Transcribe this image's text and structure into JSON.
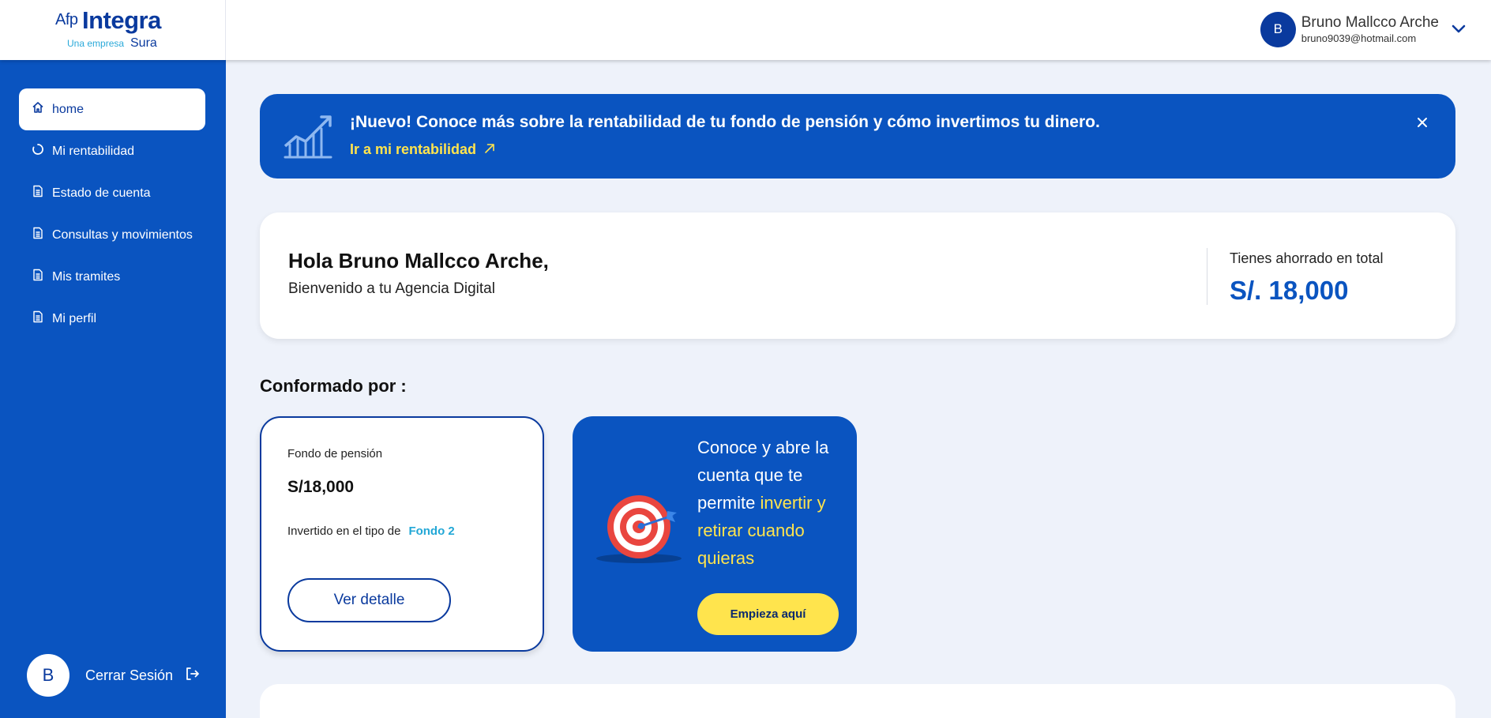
{
  "logo": {
    "afp": "Afp",
    "integra": "Integra",
    "tagline": "Una empresa",
    "parent": "Sura"
  },
  "header": {
    "avatar_initial": "B",
    "user_name": "Bruno Mallcco Arche",
    "user_email": "bruno9039@hotmail.com",
    "chevron_icon": "chevron-down-icon"
  },
  "sidebar": {
    "items": [
      {
        "label": "home",
        "icon": "home-icon",
        "active": true
      },
      {
        "label": "Mi rentabilidad",
        "icon": "loading-circle-icon",
        "active": false
      },
      {
        "label": "Estado de cuenta",
        "icon": "document-icon",
        "active": false
      },
      {
        "label": "Consultas y movimientos",
        "icon": "document-icon",
        "active": false
      },
      {
        "label": "Mis tramites",
        "icon": "document-icon",
        "active": false
      },
      {
        "label": "Mi perfil",
        "icon": "document-icon",
        "active": false
      }
    ],
    "logout": {
      "avatar_initial": "B",
      "label": "Cerrar Sesión",
      "icon": "logout-icon"
    }
  },
  "banner": {
    "icon": "growth-chart-icon",
    "title": "¡Nuevo! Conoce más sobre la rentabilidad de tu fondo de pensión y cómo invertimos tu dinero.",
    "link_label": "Ir a mi rentabilidad",
    "link_icon": "arrow-up-right-icon",
    "close_icon": "close-icon"
  },
  "greeting": {
    "title": "Hola Bruno Mallcco Arche,",
    "subtitle": "Bienvenido a tu Agencia Digital",
    "total_label": "Tienes ahorrado en total",
    "total_value": "S/. 18,000"
  },
  "section": {
    "title": "Conformado por :"
  },
  "fund": {
    "label": "Fondo de pensión",
    "amount": "S/18,000",
    "invest_label": "Invertido en el tipo de",
    "fund_type": "Fondo 2",
    "button": "Ver detalle"
  },
  "promo": {
    "icon": "target-dart-icon",
    "text_line": "Conoce y abre la cuenta que te permite",
    "text_highlight": "invertir y retirar cuando quieras",
    "button": "Empieza aquí"
  },
  "colors": {
    "primary": "#0a54c0",
    "dark_blue": "#0a3a9e",
    "accent_yellow": "#ffe44d",
    "light_blue": "#22a7d6",
    "background": "#eef2fa"
  }
}
